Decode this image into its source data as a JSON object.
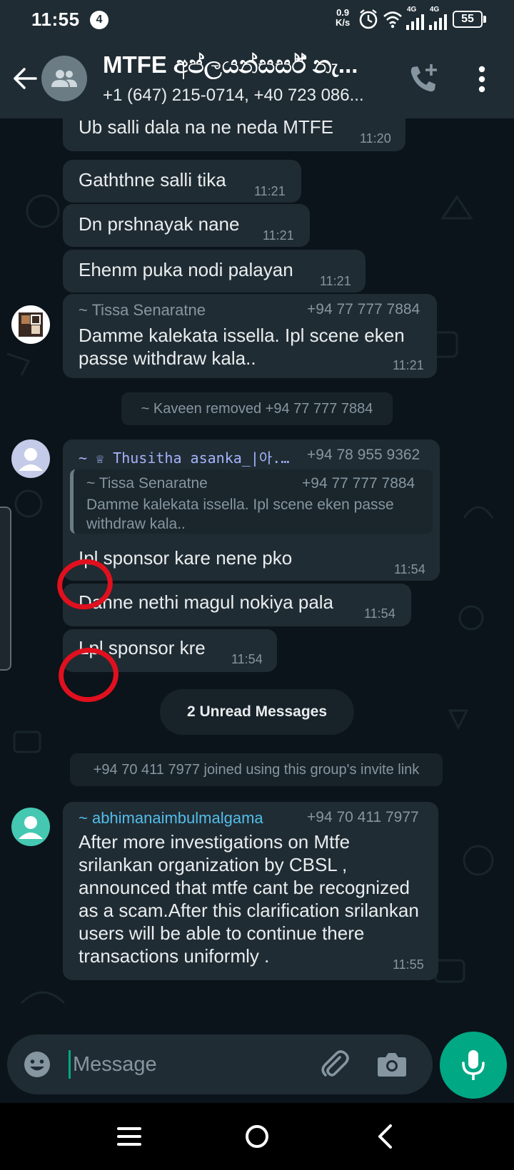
{
  "status_bar": {
    "time": "11:55",
    "notification_count": "4",
    "net_speed_value": "0.9",
    "net_speed_unit": "K/s",
    "network_1": "4G",
    "network_2": "4G",
    "battery": "55"
  },
  "header": {
    "title": "MTFE අප්ලයන්සර්ස් නැ...",
    "subtitle": "+1 (647) 215-0714, +40 723 086..."
  },
  "messages": [
    {
      "text": "Ub salli dala na ne neda MTFE",
      "time": "11:20"
    },
    {
      "text": "Gaththne salli tika",
      "time": "11:21"
    },
    {
      "text": "Dn prshnayak nane",
      "time": "11:21"
    },
    {
      "text": "Ehenm puka nodi palayan",
      "time": "11:21"
    },
    {
      "sender": "~ Tissa Senaratne",
      "phone": "+94 77 777 7884",
      "text": "Damme kalekata issella. Ipl scene eken passe withdraw kala..",
      "time": "11:21"
    }
  ],
  "system_removed": "~ Kaveen removed +94 77 777 7884",
  "reply_message": {
    "sender": "~ ♕ Thusitha asanka_|아...",
    "phone": "+94 78 955 9362",
    "quote_sender": "~ Tissa Senaratne",
    "quote_phone": "+94 77 777 7884",
    "quote_text": "Damme kalekata issella. Ipl scene eken passe withdraw kala..",
    "text": "Ipl sponsor kare nene pko",
    "time": "11:54"
  },
  "followups": [
    {
      "text": "Danne nethi magul nokiya pala",
      "time": "11:54"
    },
    {
      "text": "Lpl sponsor kre",
      "time": "11:54"
    }
  ],
  "unread_label": "2 Unread Messages",
  "system_joined": "+94 70 411 7977 joined using this group's invite link",
  "last_message": {
    "sender": "~ abhimanaimbulmalgama",
    "phone": "+94 70 411 7977",
    "text": "After more investigations on Mtfe srilankan organization by CBSL , announced that mtfe cant be recognized as a scam.After this clarification srilankan users will be able to continue there transactions uniformly .",
    "time": "11:55"
  },
  "input": {
    "placeholder": "Message"
  },
  "colors": {
    "header_bg": "#1f2c34",
    "chat_bg": "#0b141a",
    "bubble_bg": "#202c33",
    "accent": "#00a884",
    "annotation_red": "#e0101e",
    "thusitha_name": "#a5b4fc",
    "abhimana_name": "#53bdeb"
  },
  "icons": [
    "back-arrow-icon",
    "group-avatar-icon",
    "add-call-icon",
    "overflow-menu-icon",
    "emoji-icon",
    "attach-icon",
    "camera-icon",
    "mic-icon",
    "recents-icon",
    "home-icon",
    "nav-back-icon"
  ]
}
